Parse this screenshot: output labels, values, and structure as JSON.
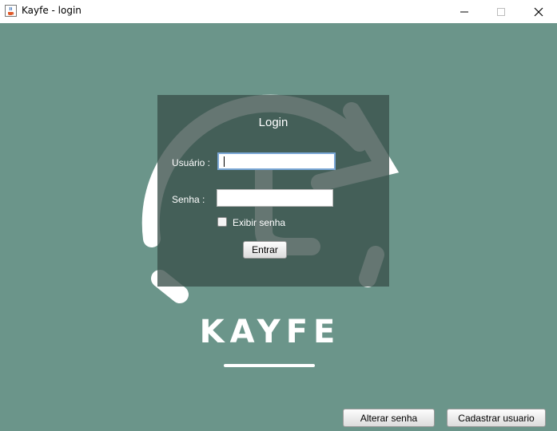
{
  "window": {
    "title": "Kayfe - login",
    "icon": "java-cup-icon",
    "controls": [
      "minimize-icon",
      "maximize-icon",
      "close-icon"
    ]
  },
  "colors": {
    "background": "#6b958a",
    "panel": "#3a504a",
    "text": "#ffffff"
  },
  "login": {
    "title": "Login",
    "username_label": "Usuário :",
    "username_value": "",
    "password_label": "Senha :",
    "password_value": "",
    "show_password_label": "Exibir senha",
    "show_password_checked": false,
    "submit_label": "Entrar"
  },
  "brand": {
    "name": "KAYFE",
    "logo_icon": "refresh-arrow-icon"
  },
  "footer": {
    "change_password_label": "Alterar senha",
    "register_label": "Cadastrar usuario"
  }
}
